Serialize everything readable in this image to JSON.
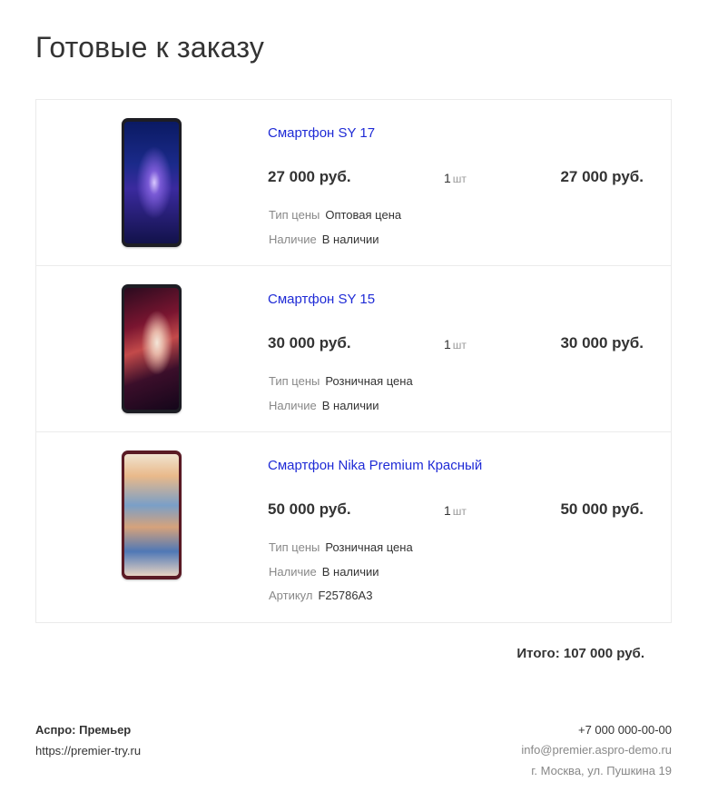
{
  "page": {
    "title": "Готовые к заказу"
  },
  "items": [
    {
      "name": "Смартфон SY 17",
      "price": "27 000 руб.",
      "qty": "1",
      "qty_unit": "шт",
      "sum": "27 000 руб.",
      "props": [
        {
          "label": "Тип цены",
          "value": "Оптовая цена"
        },
        {
          "label": "Наличие",
          "value": "В наличии"
        }
      ]
    },
    {
      "name": "Смартфон SY 15",
      "price": "30 000 руб.",
      "qty": "1",
      "qty_unit": "шт",
      "sum": "30 000 руб.",
      "props": [
        {
          "label": "Тип цены",
          "value": "Розничная цена"
        },
        {
          "label": "Наличие",
          "value": "В наличии"
        }
      ]
    },
    {
      "name": "Смартфон Nika Premium Красный",
      "price": "50 000 руб.",
      "qty": "1",
      "qty_unit": "шт",
      "sum": "50 000 руб.",
      "props": [
        {
          "label": "Тип цены",
          "value": "Розничная цена"
        },
        {
          "label": "Наличие",
          "value": "В наличии"
        },
        {
          "label": "Артикул",
          "value": "F25786A3"
        }
      ]
    }
  ],
  "total": "Итого: 107 000 руб.",
  "footer": {
    "company": "Аспро: Премьер",
    "site": "https://premier-try.ru",
    "phone": "+7 000 000-00-00",
    "email": "info@premier.aspro-demo.ru",
    "address": "г. Москва, ул. Пушкина 19"
  },
  "colors": {
    "link": "#1f2bd6",
    "text": "#333333",
    "muted": "#888888",
    "border": "#ebebeb"
  }
}
